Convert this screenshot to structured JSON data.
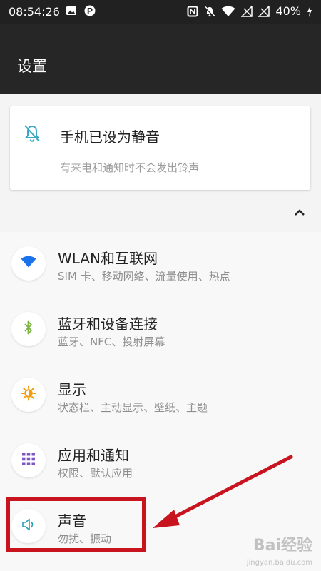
{
  "status_bar": {
    "time": "08:54:26",
    "battery": "40%",
    "left_icons": [
      "image-icon",
      "parking-p-icon"
    ],
    "right_icons": [
      "nfc-icon",
      "mute-bell-icon",
      "wifi-icon",
      "no-sim-icon",
      "no-sim-icon",
      "battery-charging-icon"
    ]
  },
  "app_bar": {
    "title": "设置"
  },
  "silent_card": {
    "title": "手机已设为静音",
    "subtitle": "有来电和通知时不会发出铃声",
    "icon": "bell-off-icon",
    "accent": "#3ba7c4"
  },
  "settings_items": [
    {
      "label": "WLAN和互联网",
      "desc": "SIM 卡、移动网络、流量使用、热点",
      "icon": "wifi-icon",
      "color": "#1a73e8"
    },
    {
      "label": "蓝牙和设备连接",
      "desc": "蓝牙、NFC、投射屏幕",
      "icon": "bluetooth-icon",
      "color": "#7cb342"
    },
    {
      "label": "显示",
      "desc": "状态栏、主动显示、壁纸、主题",
      "icon": "brightness-icon",
      "color": "#f39c12"
    },
    {
      "label": "应用和通知",
      "desc": "权限、默认应用",
      "icon": "apps-grid-icon",
      "color": "#7e57c2"
    },
    {
      "label": "声音",
      "desc": "勿扰、振动",
      "icon": "speaker-icon",
      "color": "#26a0b8"
    }
  ],
  "annotation": {
    "color": "#c8141f"
  },
  "watermark": {
    "text": "Bai经验",
    "sub": "jingyan.baidu.com"
  }
}
